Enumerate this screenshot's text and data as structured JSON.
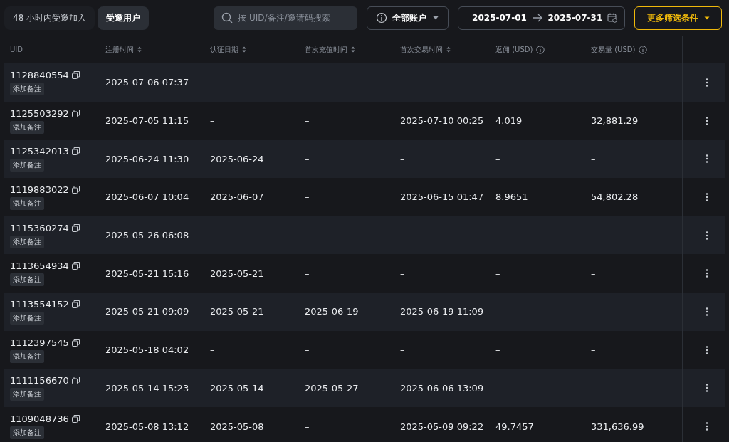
{
  "tabs": [
    {
      "label": "48 小时内受邀加入",
      "selected": false
    },
    {
      "label": "受邀用户",
      "selected": true
    }
  ],
  "search": {
    "placeholder": "按 UID/备注/邀请码搜索"
  },
  "account_filter": {
    "value": "全部账户"
  },
  "date_range": {
    "start": "2025-07-01",
    "end": "2025-07-31"
  },
  "more_filters": {
    "label": "更多筛选条件"
  },
  "table": {
    "columns": [
      {
        "label": "UID",
        "kind": "plain"
      },
      {
        "label": "注册时间",
        "kind": "sortable"
      },
      {
        "label": "认证日期",
        "kind": "sortable"
      },
      {
        "label": "首次充值时间",
        "kind": "sortable"
      },
      {
        "label": "首次交易时间",
        "kind": "sortable"
      },
      {
        "label": "返佣 (USD)",
        "kind": "explained"
      },
      {
        "label": "交易量 (USD)",
        "kind": "explained"
      }
    ],
    "rows": [
      {
        "cells": [
          "1128840554",
          "2025-07-06 07:37",
          "–",
          "–",
          "–",
          "–",
          "–"
        ],
        "note": "添加备注"
      },
      {
        "cells": [
          "1125503292",
          "2025-07-05 11:15",
          "–",
          "–",
          "2025-07-10 00:25",
          "4.019",
          "32,881.29"
        ],
        "note": "添加备注"
      },
      {
        "cells": [
          "1125342013",
          "2025-06-24 11:30",
          "2025-06-24",
          "–",
          "–",
          "–",
          "–"
        ],
        "note": "添加备注"
      },
      {
        "cells": [
          "1119883022",
          "2025-06-07 10:04",
          "2025-06-07",
          "–",
          "2025-06-15 01:47",
          "8.9651",
          "54,802.28"
        ],
        "note": "添加备注"
      },
      {
        "cells": [
          "1115360274",
          "2025-05-26 06:08",
          "–",
          "–",
          "–",
          "–",
          "–"
        ],
        "note": "添加备注"
      },
      {
        "cells": [
          "1113654934",
          "2025-05-21 15:16",
          "2025-05-21",
          "–",
          "–",
          "–",
          "–"
        ],
        "note": "添加备注"
      },
      {
        "cells": [
          "1113554152",
          "2025-05-21 09:09",
          "2025-05-21",
          "2025-06-19",
          "2025-06-19 11:09",
          "–",
          "–"
        ],
        "note": "添加备注"
      },
      {
        "cells": [
          "1112397545",
          "2025-05-18 04:02",
          "–",
          "–",
          "–",
          "–",
          "–"
        ],
        "note": "添加备注"
      },
      {
        "cells": [
          "1111156670",
          "2025-05-14 15:23",
          "2025-05-14",
          "2025-05-27",
          "2025-06-06 13:09",
          "–",
          "–"
        ],
        "note": "添加备注"
      },
      {
        "cells": [
          "1109048736",
          "2025-05-08 13:12",
          "2025-05-08",
          "–",
          "2025-05-09 09:22",
          "49.7457",
          "331,636.99"
        ],
        "note": "添加备注"
      }
    ]
  }
}
